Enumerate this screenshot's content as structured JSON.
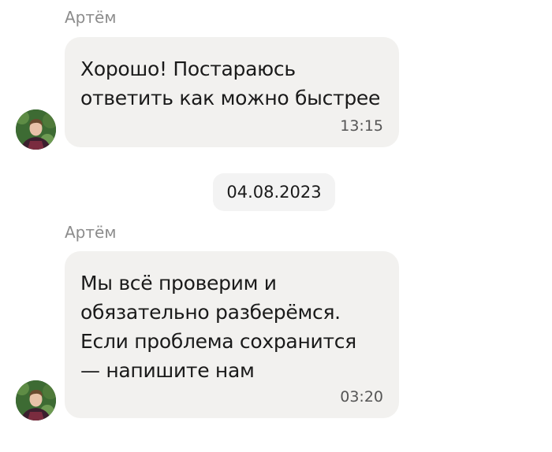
{
  "messages": [
    {
      "sender": "Артём",
      "text": "Хорошо! Постараюсь\nответить как можно быстрее",
      "time": "13:15"
    },
    {
      "sender": "Артём",
      "text": "Мы всё проверим и\nобязательно разберёмся.\nЕсли проблема сохранится\n— напишите нам",
      "time": "03:20"
    }
  ],
  "date_separator": "04.08.2023",
  "colors": {
    "bubble_bg": "#f2f1ef",
    "sender_name": "#8c8c8c",
    "date_chip_bg": "#f3f3f3"
  }
}
